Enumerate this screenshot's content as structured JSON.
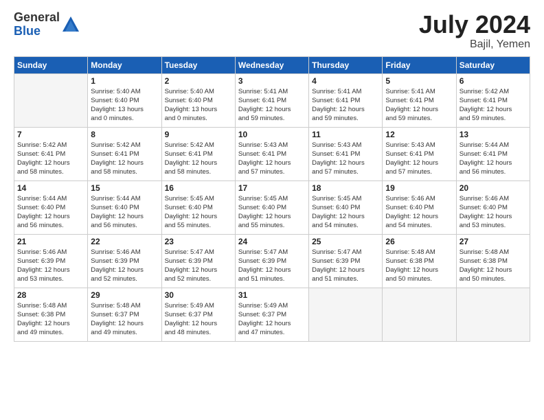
{
  "logo": {
    "general": "General",
    "blue": "Blue"
  },
  "title": {
    "month_year": "July 2024",
    "location": "Bajil, Yemen"
  },
  "weekdays": [
    "Sunday",
    "Monday",
    "Tuesday",
    "Wednesday",
    "Thursday",
    "Friday",
    "Saturday"
  ],
  "weeks": [
    [
      {
        "day": "",
        "info": ""
      },
      {
        "day": "1",
        "info": "Sunrise: 5:40 AM\nSunset: 6:40 PM\nDaylight: 13 hours\nand 0 minutes."
      },
      {
        "day": "2",
        "info": "Sunrise: 5:40 AM\nSunset: 6:40 PM\nDaylight: 13 hours\nand 0 minutes."
      },
      {
        "day": "3",
        "info": "Sunrise: 5:41 AM\nSunset: 6:41 PM\nDaylight: 12 hours\nand 59 minutes."
      },
      {
        "day": "4",
        "info": "Sunrise: 5:41 AM\nSunset: 6:41 PM\nDaylight: 12 hours\nand 59 minutes."
      },
      {
        "day": "5",
        "info": "Sunrise: 5:41 AM\nSunset: 6:41 PM\nDaylight: 12 hours\nand 59 minutes."
      },
      {
        "day": "6",
        "info": "Sunrise: 5:42 AM\nSunset: 6:41 PM\nDaylight: 12 hours\nand 59 minutes."
      }
    ],
    [
      {
        "day": "7",
        "info": "Sunrise: 5:42 AM\nSunset: 6:41 PM\nDaylight: 12 hours\nand 58 minutes."
      },
      {
        "day": "8",
        "info": "Sunrise: 5:42 AM\nSunset: 6:41 PM\nDaylight: 12 hours\nand 58 minutes."
      },
      {
        "day": "9",
        "info": "Sunrise: 5:42 AM\nSunset: 6:41 PM\nDaylight: 12 hours\nand 58 minutes."
      },
      {
        "day": "10",
        "info": "Sunrise: 5:43 AM\nSunset: 6:41 PM\nDaylight: 12 hours\nand 57 minutes."
      },
      {
        "day": "11",
        "info": "Sunrise: 5:43 AM\nSunset: 6:41 PM\nDaylight: 12 hours\nand 57 minutes."
      },
      {
        "day": "12",
        "info": "Sunrise: 5:43 AM\nSunset: 6:41 PM\nDaylight: 12 hours\nand 57 minutes."
      },
      {
        "day": "13",
        "info": "Sunrise: 5:44 AM\nSunset: 6:41 PM\nDaylight: 12 hours\nand 56 minutes."
      }
    ],
    [
      {
        "day": "14",
        "info": "Sunrise: 5:44 AM\nSunset: 6:40 PM\nDaylight: 12 hours\nand 56 minutes."
      },
      {
        "day": "15",
        "info": "Sunrise: 5:44 AM\nSunset: 6:40 PM\nDaylight: 12 hours\nand 56 minutes."
      },
      {
        "day": "16",
        "info": "Sunrise: 5:45 AM\nSunset: 6:40 PM\nDaylight: 12 hours\nand 55 minutes."
      },
      {
        "day": "17",
        "info": "Sunrise: 5:45 AM\nSunset: 6:40 PM\nDaylight: 12 hours\nand 55 minutes."
      },
      {
        "day": "18",
        "info": "Sunrise: 5:45 AM\nSunset: 6:40 PM\nDaylight: 12 hours\nand 54 minutes."
      },
      {
        "day": "19",
        "info": "Sunrise: 5:46 AM\nSunset: 6:40 PM\nDaylight: 12 hours\nand 54 minutes."
      },
      {
        "day": "20",
        "info": "Sunrise: 5:46 AM\nSunset: 6:40 PM\nDaylight: 12 hours\nand 53 minutes."
      }
    ],
    [
      {
        "day": "21",
        "info": "Sunrise: 5:46 AM\nSunset: 6:39 PM\nDaylight: 12 hours\nand 53 minutes."
      },
      {
        "day": "22",
        "info": "Sunrise: 5:46 AM\nSunset: 6:39 PM\nDaylight: 12 hours\nand 52 minutes."
      },
      {
        "day": "23",
        "info": "Sunrise: 5:47 AM\nSunset: 6:39 PM\nDaylight: 12 hours\nand 52 minutes."
      },
      {
        "day": "24",
        "info": "Sunrise: 5:47 AM\nSunset: 6:39 PM\nDaylight: 12 hours\nand 51 minutes."
      },
      {
        "day": "25",
        "info": "Sunrise: 5:47 AM\nSunset: 6:39 PM\nDaylight: 12 hours\nand 51 minutes."
      },
      {
        "day": "26",
        "info": "Sunrise: 5:48 AM\nSunset: 6:38 PM\nDaylight: 12 hours\nand 50 minutes."
      },
      {
        "day": "27",
        "info": "Sunrise: 5:48 AM\nSunset: 6:38 PM\nDaylight: 12 hours\nand 50 minutes."
      }
    ],
    [
      {
        "day": "28",
        "info": "Sunrise: 5:48 AM\nSunset: 6:38 PM\nDaylight: 12 hours\nand 49 minutes."
      },
      {
        "day": "29",
        "info": "Sunrise: 5:48 AM\nSunset: 6:37 PM\nDaylight: 12 hours\nand 49 minutes."
      },
      {
        "day": "30",
        "info": "Sunrise: 5:49 AM\nSunset: 6:37 PM\nDaylight: 12 hours\nand 48 minutes."
      },
      {
        "day": "31",
        "info": "Sunrise: 5:49 AM\nSunset: 6:37 PM\nDaylight: 12 hours\nand 47 minutes."
      },
      {
        "day": "",
        "info": ""
      },
      {
        "day": "",
        "info": ""
      },
      {
        "day": "",
        "info": ""
      }
    ]
  ]
}
